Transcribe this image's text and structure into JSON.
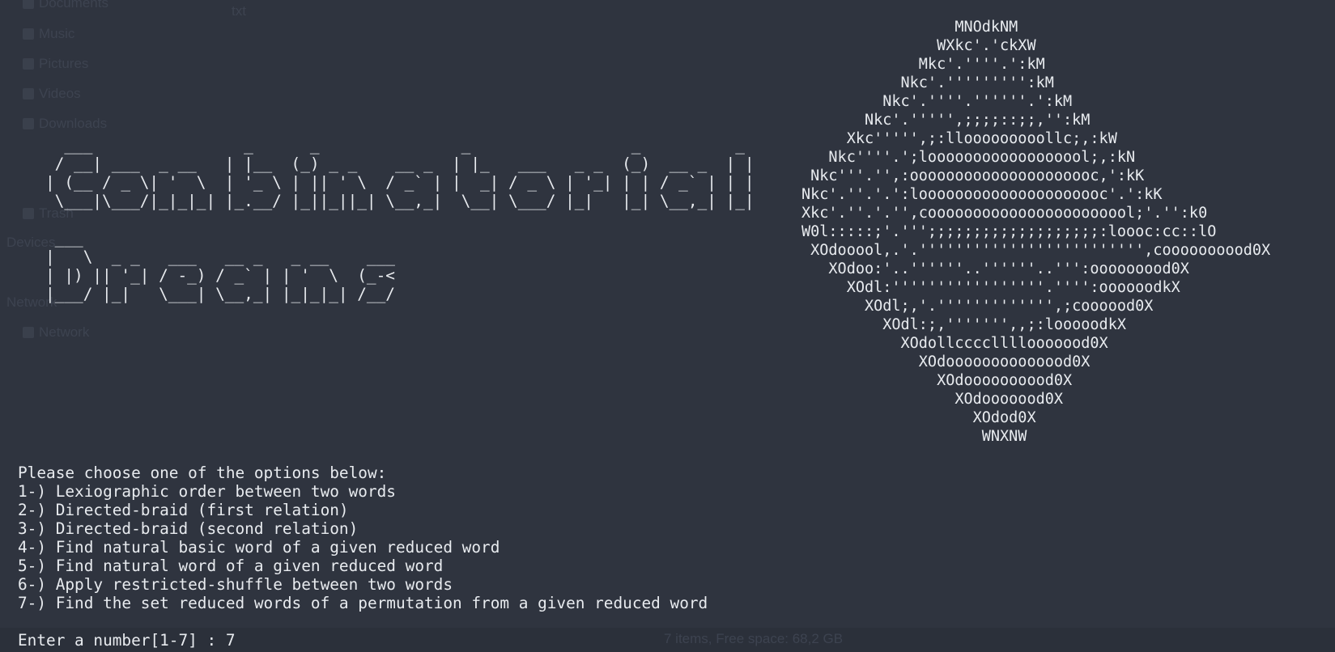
{
  "background": {
    "sidebar_items": [
      {
        "label": "Documents",
        "icon": "document-icon"
      },
      {
        "label": "Music",
        "icon": "music-icon"
      },
      {
        "label": "Pictures",
        "icon": "picture-icon"
      },
      {
        "label": "Videos",
        "icon": "video-icon"
      },
      {
        "label": "Downloads",
        "icon": "download-icon"
      },
      {
        "label": "Trash",
        "icon": "trash-icon"
      },
      {
        "label": "Network",
        "icon": "network-icon"
      }
    ],
    "sidebar_sections": [
      "Devices",
      "Network"
    ],
    "file_label": "txt",
    "status_text": "7 items, Free space: 68,2 GB"
  },
  "terminal": {
    "banner_title_lines": [
      "  ___                _      _               _                 _          _ ",
      " / __| ___  _ __   | |__  (_) _ _    __ _  | |_   ___   _ _  (_)  __ _  | |",
      "| (__ / _ \\| '  \\  | '_ \\ | || ' \\  / _` | |  _| / _ \\ | '_| | | / _` | | |",
      " \\___|\\___/|_|_|_| |_.__/ |_||_||_| \\__,_|  \\__| \\___/ |_|   |_| \\__,_| |_|"
    ],
    "banner_subtitle_lines": [
      " ___                                    ",
      "|   \\  _ _   ___   __ _   _ __    ___  ",
      "| |) || '_| / -_) / _` | | '  \\  (_-<  ",
      "|___/ |_|   \\___| \\__,_| |_|_|_| /__/  "
    ],
    "ascii_logo_lines": [
      "                 MNOdkNM",
      "               WXkc'.'ckXW",
      "             Mkc'.''''.':kM",
      "           Nkc'.''''''''':kM",
      "         Nkc'.''''.''''''.':kM",
      "       Nkc'.''''',;;;;::;;,'':kM",
      "     Xkc''''',;:llooooooooollc;,:kW",
      "   Nkc''''.';loooooooooooooooool;,:kN",
      " Nkc'''.'',:ooooooooooooooooooooc,':kK",
      "Nkc'.''.'.':looooooooooooooooooooc'.':kK",
      "Xkc'.''.'.'',cooooooooooooooooooooool;'.'':k0",
      "W0l:::::;'.''';;;;;;;;;;;;;;;;;;;:loooc:cc::lO",
      " XOdooool,.'.''''''''''''''''''''''''',coooooooood0X",
      "   XOdoo:'..''''''..''''''..''':ooooooood0X",
      "     XOdl:'''''''''''''''''.'''':oooooodkX",
      "       XOdl;,'.''''''''''''',;coooood0X",
      "         XOdl:;,''''''',,;:looooodkX",
      "           XOdollccccllllooooood0X",
      "             XOdoooooooooooood0X",
      "               XOdoooooooood0X",
      "                 XOdooooood0X",
      "                   XOdod0X",
      "                    WNXNW"
    ],
    "menu_lines": [
      "Please choose one of the options below:",
      "1-) Lexiographic order between two words",
      "2-) Directed-braid (first relation)",
      "3-) Directed-braid (second relation)",
      "4-) Find natural basic word of a given reduced word",
      "5-) Find natural word of a given reduced word",
      "6-) Apply restricted-shuffle between two words",
      "7-) Find the set reduced words of a permutation from a given reduced word"
    ],
    "prompt": "Enter a number[1-7] : 7"
  }
}
